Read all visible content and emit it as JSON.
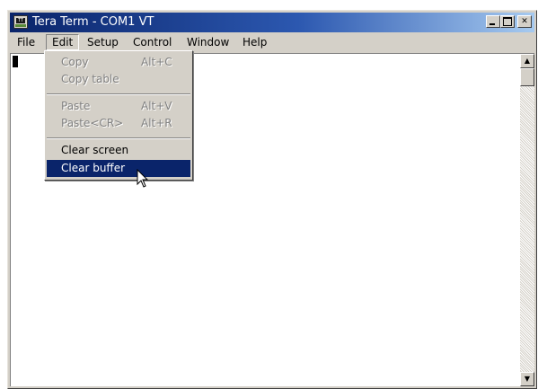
{
  "window": {
    "title": "Tera Term - COM1 VT",
    "icon_name": "teraterm-app-icon",
    "icon_text": "TT",
    "controls": [
      "minimize",
      "maximize",
      "close"
    ]
  },
  "menubar": {
    "items": [
      {
        "label": "File",
        "name": "menu-file"
      },
      {
        "label": "Edit",
        "name": "menu-edit",
        "active": true
      },
      {
        "label": "Setup",
        "name": "menu-setup"
      },
      {
        "label": "Control",
        "name": "menu-control"
      },
      {
        "label": "Window",
        "name": "menu-window"
      },
      {
        "label": "Help",
        "name": "menu-help"
      }
    ]
  },
  "edit_menu": {
    "items": [
      {
        "label": "Copy",
        "shortcut": "Alt+C",
        "enabled": false
      },
      {
        "label": "Copy table",
        "shortcut": "",
        "enabled": false
      },
      {
        "label": "Paste",
        "shortcut": "Alt+V",
        "enabled": false
      },
      {
        "label": "Paste<CR>",
        "shortcut": "Alt+R",
        "enabled": false
      },
      {
        "label": "Clear screen",
        "shortcut": "",
        "enabled": true
      },
      {
        "label": "Clear buffer",
        "shortcut": "",
        "enabled": true,
        "highlighted": true
      }
    ]
  },
  "colors": {
    "titlebar_start": "#0a246a",
    "titlebar_end": "#a6caf0",
    "menu_highlight": "#0a246a",
    "face": "#d4d0c8"
  }
}
